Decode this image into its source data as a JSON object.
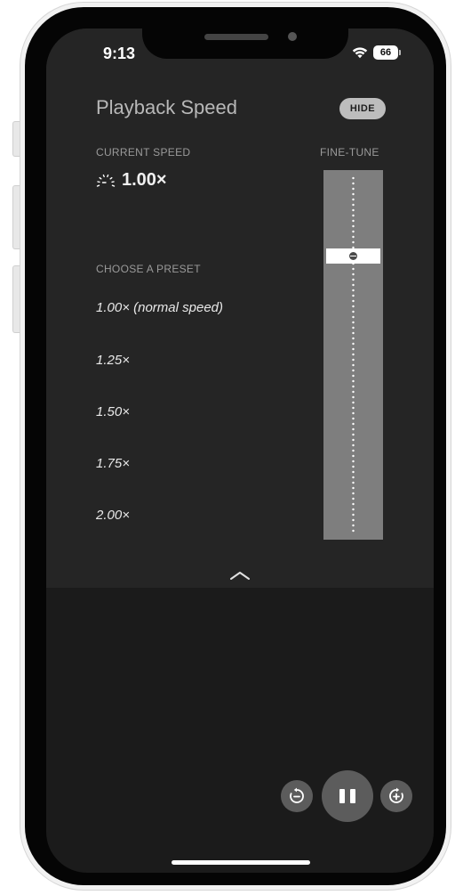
{
  "status_bar": {
    "time": "9:13",
    "battery": "66"
  },
  "header": {
    "title": "Playback Speed",
    "hide_label": "HIDE"
  },
  "current": {
    "label": "CURRENT SPEED",
    "speed": "1.00×"
  },
  "fine_tune": {
    "label": "FINE-TUNE",
    "level": 0.22
  },
  "presets": {
    "label": "CHOOSE A PRESET",
    "items": [
      {
        "label": "1.00× (normal speed)"
      },
      {
        "label": "1.25×"
      },
      {
        "label": "1.50×"
      },
      {
        "label": "1.75×"
      },
      {
        "label": "2.00×"
      }
    ]
  },
  "icons": {
    "gauge": "speed-gauge-icon",
    "collapse": "chevron-up-icon",
    "rewind": "skip-back-icon",
    "pause": "pause-icon",
    "forward": "skip-forward-icon"
  },
  "colors": {
    "panel_bg": "#252525",
    "screen_bg": "#1b1b1b",
    "slider_track": "#7e7e7e",
    "control_bg": "#5c5c5c"
  }
}
